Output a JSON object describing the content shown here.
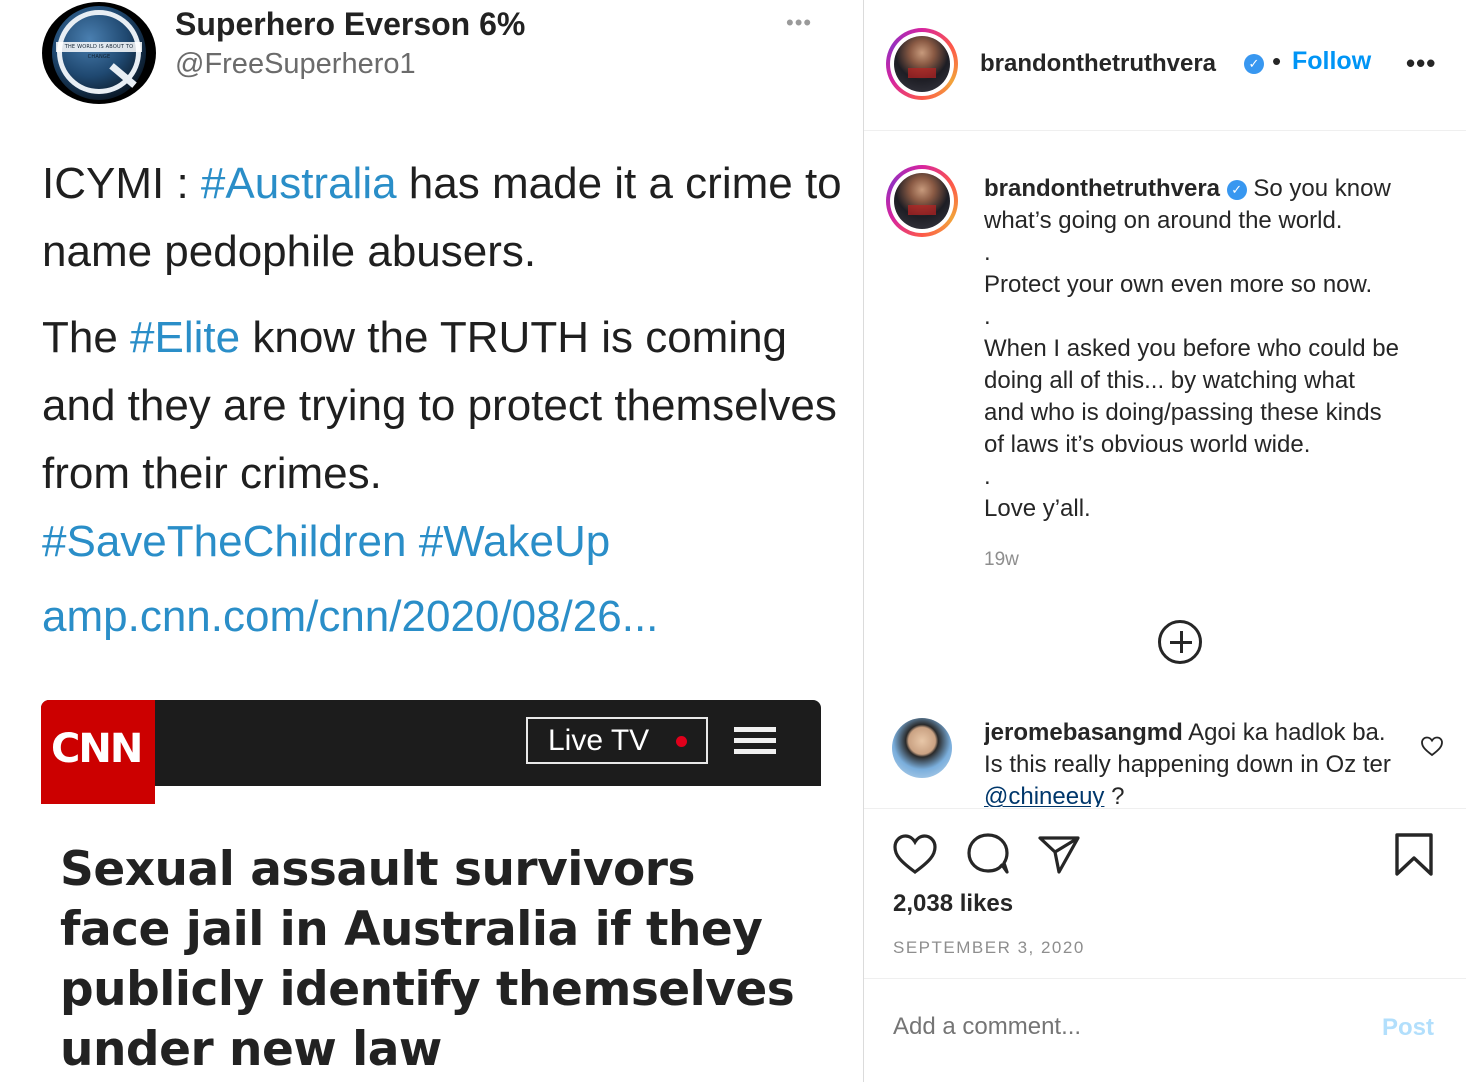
{
  "tweet": {
    "avatar_banner_text": "THE WORLD IS ABOUT TO CHANGE",
    "display_name": "Superhero Everson 6%",
    "handle": "@FreeSuperhero1",
    "more": "•••",
    "para1_before": "ICYMI : ",
    "para1_tag": "#Australia",
    "para1_after": " has made it a crime to name pedophile abusers.",
    "para2_before": "The ",
    "para2_tag": "#Elite",
    "para2_after": " know the TRUTH is coming and they are trying to protect themselves from their crimes.",
    "tag_save": "#SaveTheChildren",
    "tag_wake": "#WakeUp",
    "link": "amp.cnn.com/cnn/2020/08/26...",
    "cnn_logo": "CNN",
    "live_tv": "Live TV",
    "headline": "Sexual assault survivors face jail in Australia if they publicly identify themselves under new law"
  },
  "post": {
    "username": "brandonthetruthvera",
    "dot": "•",
    "follow": "Follow",
    "more": "•••",
    "caption_lines": [
      "So you know",
      "what’s going on around the world.",
      ".",
      "Protect your own even more so now.",
      ".",
      "When I asked you before who could be",
      "doing all of this... by watching what",
      "and who is doing/passing these kinds",
      "of laws it’s obvious world wide.",
      ".",
      "Love y’all."
    ],
    "time_ago": "19w",
    "comment": {
      "username": "jeromebasangmd",
      "text": " Agoi ka hadlok ba. Is this really happening down in Oz ter ",
      "mention": "@chineeuy",
      "tail": " ?"
    },
    "likes": "2,038 likes",
    "date": "SEPTEMBER 3, 2020",
    "add_comment_placeholder": "Add a comment...",
    "post_label": "Post"
  },
  "colors": {
    "hashtag": "#2a8ec8",
    "follow": "#0095f6",
    "post_disabled": "#b2dffc",
    "cnn_red": "#cc0000"
  }
}
